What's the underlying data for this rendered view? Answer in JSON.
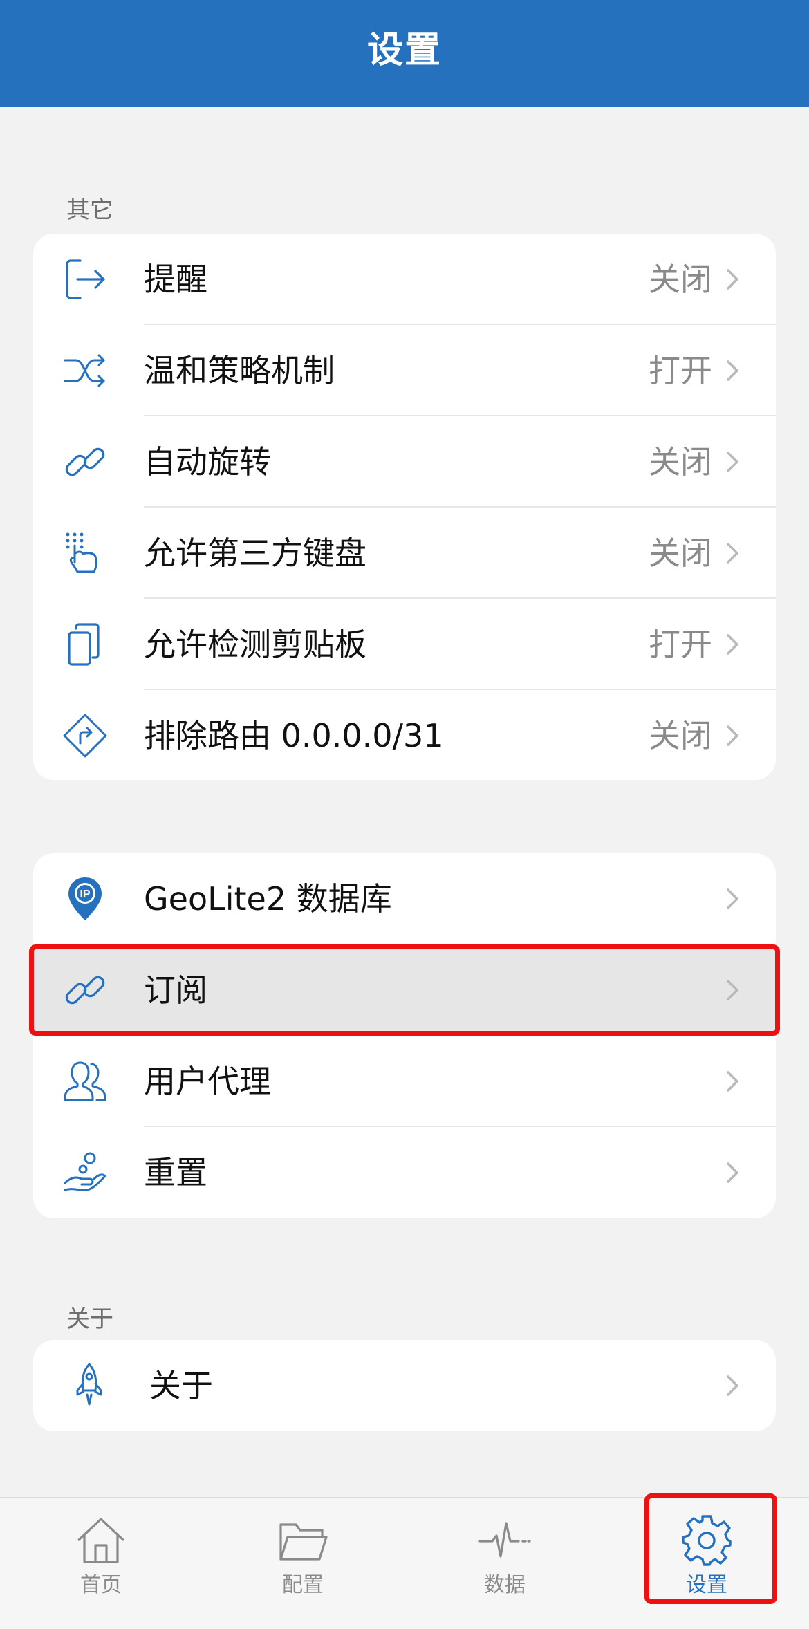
{
  "app": {
    "title": "设置"
  },
  "colors": {
    "accent": "#2571bd",
    "highlight": "#ee1111"
  },
  "sections": {
    "other": {
      "header": "其它",
      "items": [
        {
          "label": "提醒",
          "value": "关闭",
          "icon": "exit-arrow-icon"
        },
        {
          "label": "温和策略机制",
          "value": "打开",
          "icon": "shuffle-icon"
        },
        {
          "label": "自动旋转",
          "value": "关闭",
          "icon": "link-icon"
        },
        {
          "label": "允许第三方键盘",
          "value": "关闭",
          "icon": "keypad-tap-icon"
        },
        {
          "label": "允许检测剪贴板",
          "value": "打开",
          "icon": "copy-icon"
        },
        {
          "label": "排除路由 0.0.0.0/31",
          "value": "关闭",
          "icon": "route-sign-icon"
        }
      ]
    },
    "misc": {
      "items": [
        {
          "label": "GeoLite2 数据库",
          "icon": "ip-pin-icon"
        },
        {
          "label": "订阅",
          "icon": "link-icon",
          "selected": true
        },
        {
          "label": "用户代理",
          "icon": "users-icon"
        },
        {
          "label": "重置",
          "icon": "hand-coin-icon"
        }
      ]
    },
    "about": {
      "header": "关于",
      "items": [
        {
          "label": "关于",
          "icon": "rocket-icon"
        }
      ]
    }
  },
  "tabbar": {
    "tabs": [
      {
        "label": "首页",
        "icon": "home-icon"
      },
      {
        "label": "配置",
        "icon": "folder-icon"
      },
      {
        "label": "数据",
        "icon": "pulse-icon"
      },
      {
        "label": "设置",
        "icon": "gear-icon",
        "active": true
      }
    ]
  }
}
